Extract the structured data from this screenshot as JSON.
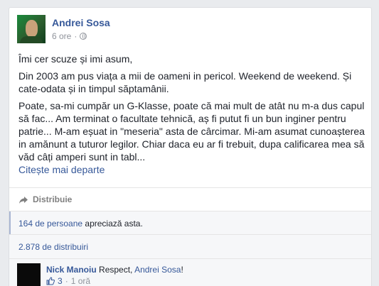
{
  "post": {
    "author": "Andrei Sosa",
    "time": "6 ore",
    "separator": "·",
    "paragraphs": {
      "p1": "Îmi cer scuze și imi asum,",
      "p2": "Din 2003 am pus viața a mii de oameni in pericol. Weekend de weekend. Și cate-odata și in timpul săptamânii.",
      "p3": "Poate, sa-mi cumpăr un G-Klasse, poate că mai mult de atât nu m-a dus capul să fac... Am terminat o facultate tehnică, aș fi putut fi un bun inginer pentru patrie... M-am eșuat in \"meseria\" asta de cârcimar. Mi-am asumat cunoașterea in amănunt a tuturor legilor. Chiar daca eu ar fi trebuit, dupa calificarea mea să văd câți amperi sunt in tabl..."
    },
    "see_more": "Citește mai departe"
  },
  "actions": {
    "share_label": "Distribuie"
  },
  "likes": {
    "count_link": "164 de persoane",
    "suffix": " apreciază asta."
  },
  "shares": {
    "label": "2.878 de distribuiri"
  },
  "comment": {
    "author": "Nick Manoiu",
    "text_before": " Respect, ",
    "mention": "Andrei Sosa",
    "text_after": "!",
    "likes": "3",
    "separator": "·",
    "time": "1 oră"
  },
  "colors": {
    "link": "#365899",
    "meta": "#90949c",
    "background": "#e9ebee"
  },
  "icons": [
    "globe-icon",
    "share-icon",
    "thumbs-up-icon"
  ]
}
